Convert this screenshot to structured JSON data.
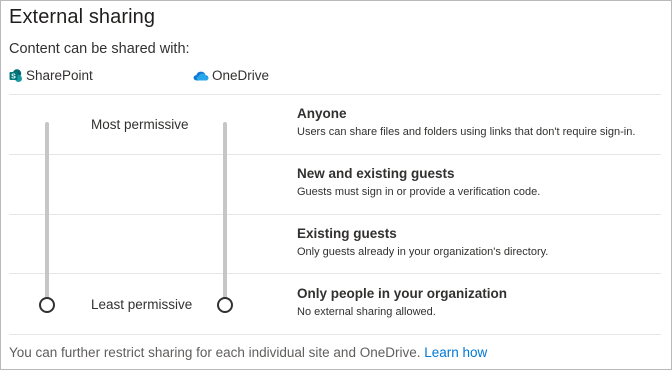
{
  "page": {
    "title": "External sharing",
    "subtitle": "Content can be shared with:"
  },
  "services": [
    {
      "name": "SharePoint",
      "icon": "sharepoint-icon",
      "color": "#036c70"
    },
    {
      "name": "OneDrive",
      "icon": "onedrive-icon",
      "color": "#0364b8"
    }
  ],
  "slider": {
    "top_label": "Most permissive",
    "bottom_label": "Least permissive",
    "sharepoint_selected": "Only people in your organization",
    "onedrive_selected": "Only people in your organization"
  },
  "options": [
    {
      "title": "Anyone",
      "description": "Users can share files and folders using links that don't require sign-in."
    },
    {
      "title": "New and existing guests",
      "description": "Guests must sign in or provide a verification code."
    },
    {
      "title": "Existing guests",
      "description": "Only guests already in your organization's directory."
    },
    {
      "title": "Only people in your organization",
      "description": "No external sharing allowed."
    }
  ],
  "footer": {
    "text": "You can further restrict sharing for each individual site and OneDrive.",
    "link_label": "Learn how"
  },
  "colors": {
    "accent": "#0078d4",
    "track": "#c8c6c4"
  }
}
